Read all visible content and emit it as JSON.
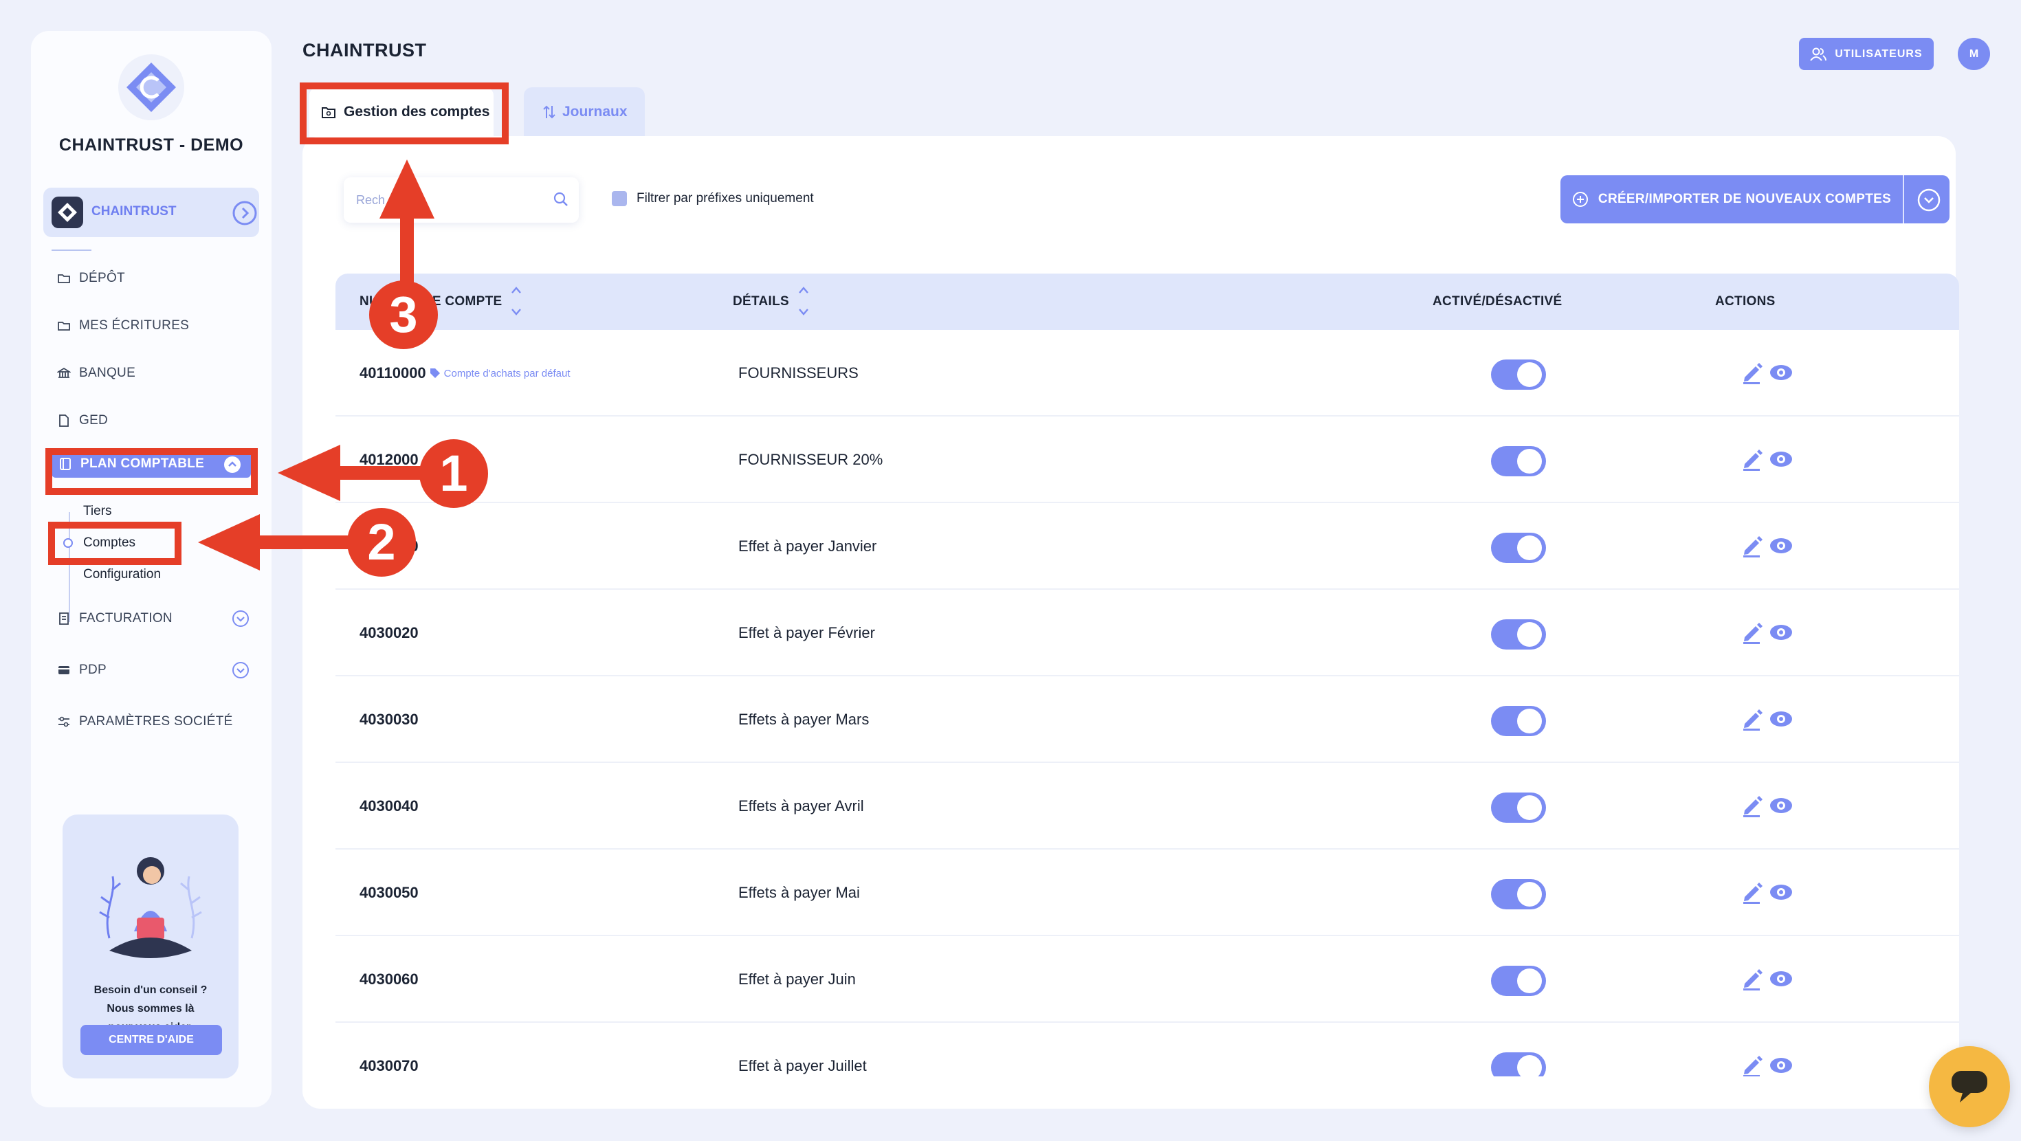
{
  "app": {
    "title": "CHAINTRUST",
    "brand_name": "CHAINTRUST - DEMO",
    "org_switch_label": "CHAINTRUST",
    "users_button": "UTILISATEURS",
    "avatar_initial": "M"
  },
  "sidebar": {
    "items": [
      {
        "label": "DÉPÔT",
        "icon": "folder-icon"
      },
      {
        "label": "MES ÉCRITURES",
        "icon": "folder-icon"
      },
      {
        "label": "BANQUE",
        "icon": "bank-icon"
      },
      {
        "label": "GED",
        "icon": "document-icon"
      },
      {
        "label": "PLAN COMPTABLE",
        "icon": "ledger-icon",
        "active": true
      },
      {
        "label": "FACTURATION",
        "icon": "invoice-icon"
      },
      {
        "label": "PDP",
        "icon": "card-icon"
      },
      {
        "label": "PARAMÈTRES SOCIÉTÉ",
        "icon": "sliders-icon"
      }
    ],
    "subitems": [
      "Tiers",
      "Comptes",
      "Configuration"
    ]
  },
  "help": {
    "line1": "Besoin d'un conseil ?",
    "line2": "Nous sommes là",
    "line3": "pour vous aider.",
    "button": "CENTRE D'AIDE"
  },
  "tabs": [
    {
      "label": "Gestion des comptes",
      "active": true
    },
    {
      "label": "Journaux",
      "active": false
    }
  ],
  "toolbar": {
    "search_placeholder": "Rech",
    "filter_label": "Filtrer par préfixes uniquement",
    "create_button": "CRÉER/IMPORTER DE NOUVEAUX COMPTES"
  },
  "table": {
    "headers": {
      "number": "NUMÉRO DE COMPTE",
      "details": "DÉTAILS",
      "active": "ACTIVÉ/DÉSACTIVÉ",
      "actions": "ACTIONS"
    },
    "rows": [
      {
        "number": "40110000",
        "badge": "Compte d'achats par défaut",
        "details": "FOURNISSEURS",
        "active": true
      },
      {
        "number": "4012000",
        "badge": "",
        "details": "FOURNISSEUR 20%",
        "active": true
      },
      {
        "number": "4030010",
        "badge": "",
        "details": "Effet à payer Janvier",
        "active": true
      },
      {
        "number": "4030020",
        "badge": "",
        "details": "Effet à payer Février",
        "active": true
      },
      {
        "number": "4030030",
        "badge": "",
        "details": "Effets à payer Mars",
        "active": true
      },
      {
        "number": "4030040",
        "badge": "",
        "details": "Effets à payer Avril",
        "active": true
      },
      {
        "number": "4030050",
        "badge": "",
        "details": "Effets à payer Mai",
        "active": true
      },
      {
        "number": "4030060",
        "badge": "",
        "details": "Effet à payer Juin",
        "active": true
      },
      {
        "number": "4030070",
        "badge": "",
        "details": "Effet à payer Juillet",
        "active": true
      }
    ]
  },
  "annotations": {
    "callout_1": "1",
    "callout_2": "2",
    "callout_3": "3",
    "color": "#e53e28"
  },
  "colors": {
    "accent": "#7b8cf3",
    "background": "#eef1fb",
    "chat": "#f5b842"
  }
}
